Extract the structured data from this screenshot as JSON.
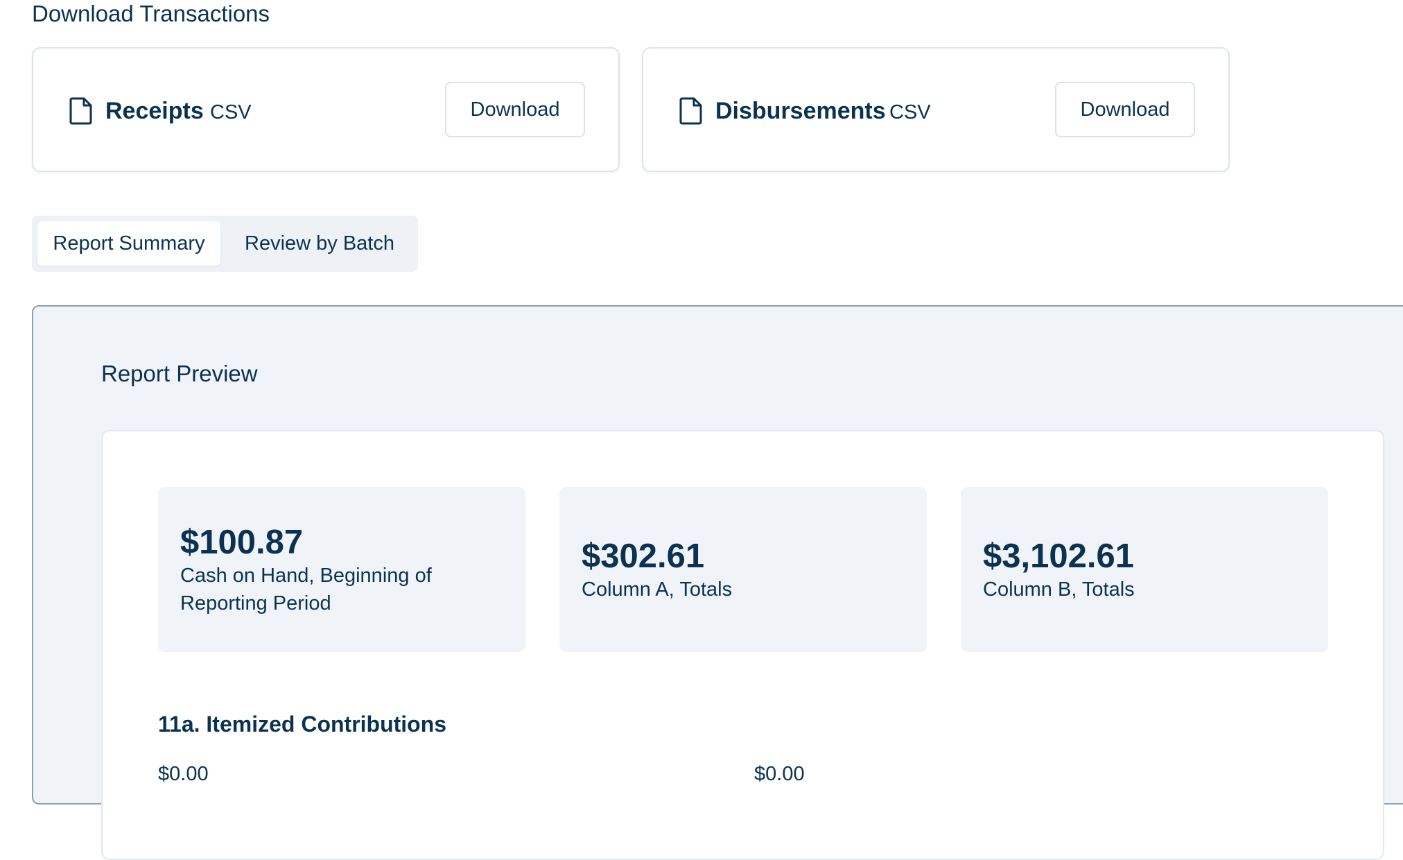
{
  "download_section": {
    "title": "Download Transactions",
    "cards": [
      {
        "name": "Receipts",
        "format": "CSV",
        "button_label": "Download"
      },
      {
        "name": "Disbursements",
        "format": "CSV",
        "button_label": "Download"
      }
    ]
  },
  "tabs": [
    {
      "label": "Report Summary",
      "active": true
    },
    {
      "label": "Review by Batch",
      "active": false
    }
  ],
  "preview": {
    "title": "Report Preview",
    "stats": [
      {
        "value": "$100.87",
        "label": "Cash on Hand, Beginning of Reporting Period"
      },
      {
        "value": "$302.61",
        "label": "Column A, Totals"
      },
      {
        "value": "$3,102.61",
        "label": "Column B, Totals"
      }
    ],
    "line_item": {
      "heading": "11a. Itemized Contributions",
      "column_a": "$0.00",
      "column_b": "$0.00"
    }
  },
  "colors": {
    "text": "#0b3250",
    "card_border": "#dde3ea",
    "panel_bg": "#f0f3f8",
    "panel_border": "#8fa0b5"
  },
  "icons": {
    "file": "file-icon"
  }
}
